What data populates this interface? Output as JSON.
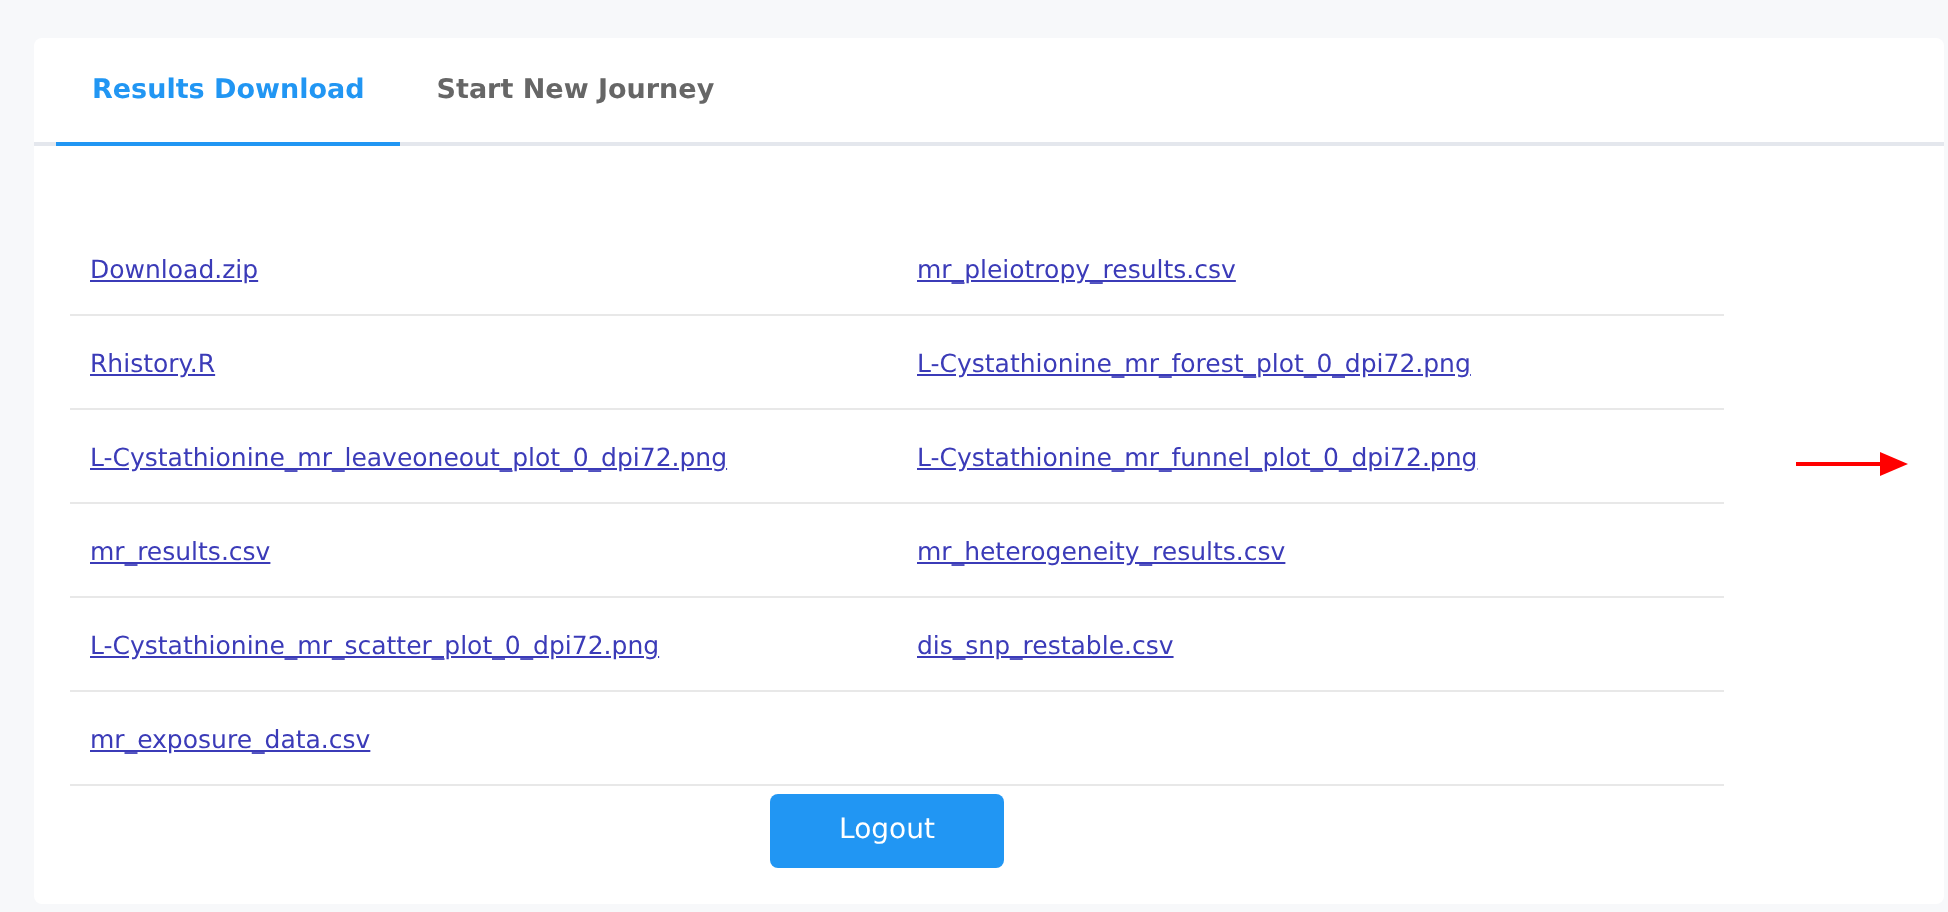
{
  "tabs": [
    {
      "label": "Results Download",
      "selected": true
    },
    {
      "label": "Start New Journey",
      "selected": false
    }
  ],
  "file_rows": [
    [
      "Download.zip",
      "mr_pleiotropy_results.csv"
    ],
    [
      "Rhistory.R",
      "L-Cystathionine_mr_forest_plot_0_dpi72.png"
    ],
    [
      "L-Cystathionine_mr_leaveoneout_plot_0_dpi72.png",
      "L-Cystathionine_mr_funnel_plot_0_dpi72.png"
    ],
    [
      "mr_results.csv",
      "mr_heterogeneity_results.csv"
    ],
    [
      "L-Cystathionine_mr_scatter_plot_0_dpi72.png",
      "dis_snp_restable.csv"
    ],
    [
      "mr_exposure_data.csv"
    ]
  ],
  "logout_button": "Logout"
}
